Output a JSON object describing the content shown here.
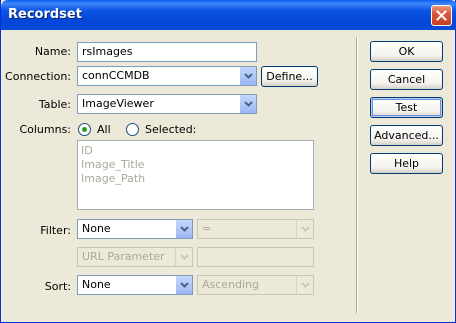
{
  "window": {
    "title": "Recordset"
  },
  "form": {
    "name_label": "Name:",
    "name_value": "rsImages",
    "connection_label": "Connection:",
    "connection_value": "connCCMDB",
    "define_button": "Define...",
    "table_label": "Table:",
    "table_value": "ImageViewer",
    "columns_label": "Columns:",
    "columns_all": "All",
    "columns_selected": "Selected:",
    "columns_list": [
      "ID",
      "Image_Title",
      "Image_Path"
    ],
    "filter_label": "Filter:",
    "filter_value": "None",
    "filter_operator": "=",
    "filter_param": "URL Parameter",
    "filter_param_value": "",
    "sort_label": "Sort:",
    "sort_value": "None",
    "sort_order": "Ascending"
  },
  "buttons": {
    "ok": "OK",
    "cancel": "Cancel",
    "test": "Test",
    "advanced": "Advanced...",
    "help": "Help"
  },
  "colors": {
    "title_bar": "#0a55e6",
    "dialog_bg": "#ece9d8",
    "radio_checked": "#21a121"
  }
}
